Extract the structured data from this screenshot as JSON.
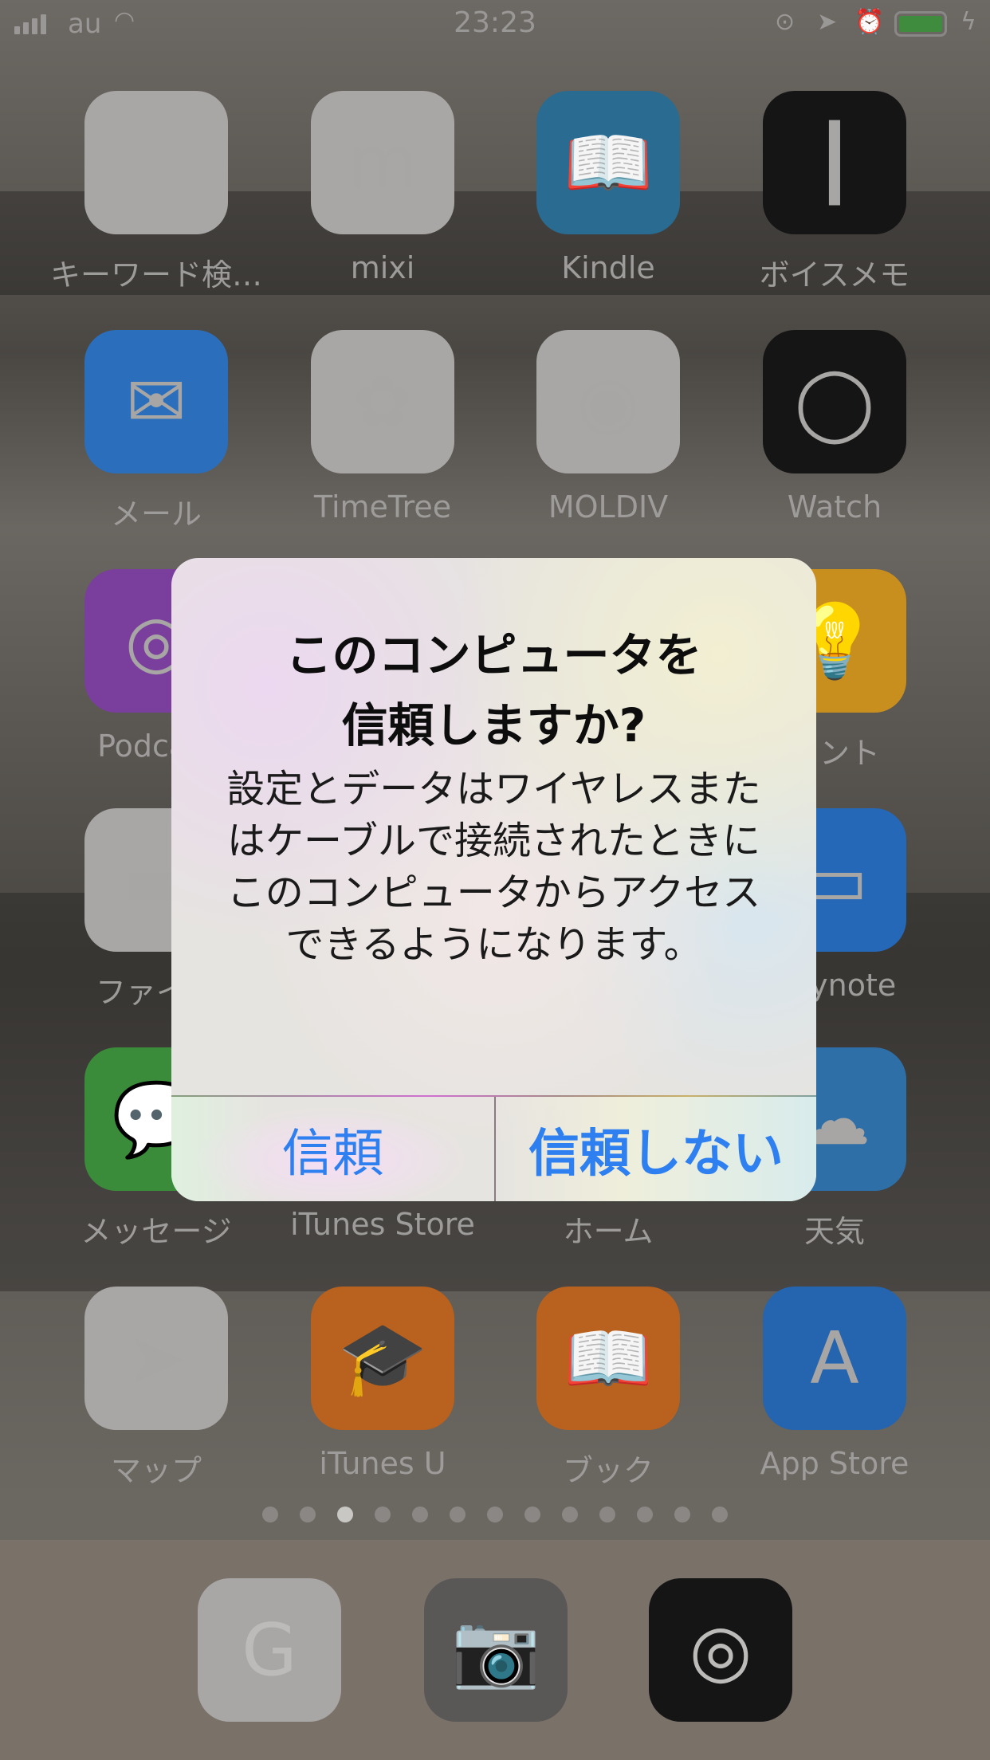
{
  "status_bar": {
    "carrier": "au",
    "time": "23:23",
    "battery_color": "#3f8c3f",
    "icons": [
      "signal-icon",
      "wifi-icon",
      "orientation-lock-icon",
      "location-icon",
      "alarm-icon",
      "battery-icon",
      "charging-icon"
    ]
  },
  "apps": [
    {
      "label": "キーワード検…",
      "icon": "blank-icon",
      "color": "#a9a7a5"
    },
    {
      "label": "mixi",
      "icon": "mixi-icon",
      "color": "#a9a7a5"
    },
    {
      "label": "Kindle",
      "icon": "kindle-icon",
      "color": "#2a6b92"
    },
    {
      "label": "ボイスメモ",
      "icon": "waveform-icon",
      "color": "#151515"
    },
    {
      "label": "メール",
      "icon": "mail-icon",
      "color": "#2b6fbc"
    },
    {
      "label": "TimeTree",
      "icon": "tree-icon",
      "color": "#a9a7a5"
    },
    {
      "label": "MOLDIV",
      "icon": "lens-icon",
      "color": "#a9a7a5"
    },
    {
      "label": "Watch",
      "icon": "watch-icon",
      "color": "#151515"
    },
    {
      "label": "Podcast",
      "icon": "podcast-icon",
      "color": "#7a3f9c"
    },
    {
      "label": "",
      "icon": "",
      "color": ""
    },
    {
      "label": "",
      "icon": "",
      "color": ""
    },
    {
      "label": "ヒント",
      "icon": "lightbulb-icon",
      "color": "#c98f1e"
    },
    {
      "label": "ファイル",
      "icon": "folder-icon",
      "color": "#a9a7a5"
    },
    {
      "label": "",
      "icon": "",
      "color": ""
    },
    {
      "label": "",
      "icon": "",
      "color": ""
    },
    {
      "label": "Keynote",
      "icon": "keynote-icon",
      "color": "#2568b8"
    },
    {
      "label": "メッセージ",
      "icon": "messages-icon",
      "color": "#3a8c3a"
    },
    {
      "label": "iTunes Store",
      "icon": "itunes-icon",
      "color": "#a04aa0"
    },
    {
      "label": "ホーム",
      "icon": "home-icon",
      "color": "#c88a1e"
    },
    {
      "label": "天気",
      "icon": "weather-icon",
      "color": "#2f6fa8"
    },
    {
      "label": "マップ",
      "icon": "maps-icon",
      "color": "#a9a7a5"
    },
    {
      "label": "iTunes U",
      "icon": "graduation-cap-icon",
      "color": "#b9611e"
    },
    {
      "label": "ブック",
      "icon": "book-icon",
      "color": "#b9611e"
    },
    {
      "label": "App Store",
      "icon": "app-store-icon",
      "color": "#2565b0"
    }
  ],
  "page_dots": {
    "count": 13,
    "active": 3
  },
  "dock": [
    {
      "icon": "google-icon",
      "color": "#a9a7a5",
      "glyph": "G"
    },
    {
      "icon": "camera-icon",
      "color": "#5a5856",
      "glyph": "📷"
    },
    {
      "icon": "dial-icon",
      "color": "#151515",
      "glyph": "◎"
    }
  ],
  "dialog": {
    "title_line1": "このコンピュータを",
    "title_line2": "信頼しますか?",
    "message": "設定とデータはワイヤレスまたはケーブルで接続されたときにこのコンピュータからアクセスできるようになります。",
    "trust_button": "信頼",
    "dont_trust_button": "信頼しない",
    "button_color": "#2e7ff0"
  }
}
